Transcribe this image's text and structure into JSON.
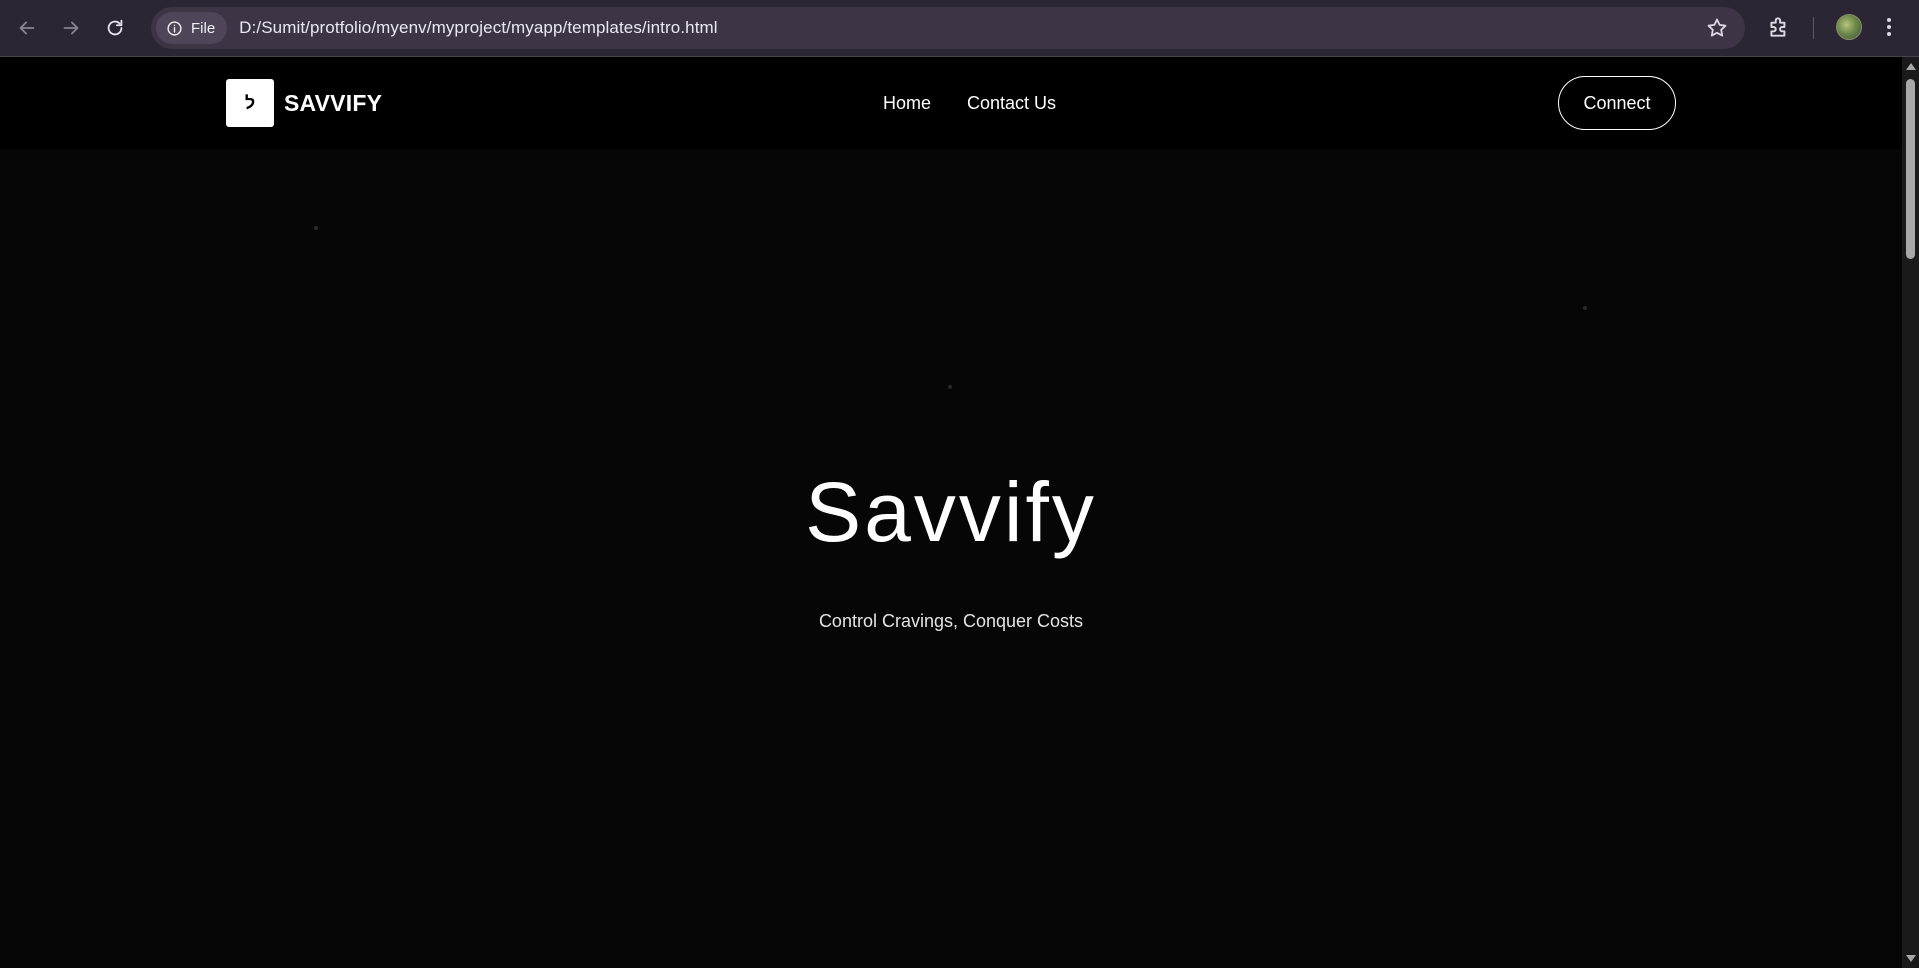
{
  "browser": {
    "site_chip_label": "File",
    "url": "D:/Sumit/protfolio/myenv/myproject/myapp/templates/intro.html",
    "icons": [
      "back-arrow-icon",
      "forward-arrow-icon",
      "reload-icon",
      "info-icon",
      "star-icon",
      "extensions-icon",
      "profile-avatar",
      "more-vert-icon"
    ]
  },
  "site": {
    "logo_glyph": "ל",
    "brand_name": "SAVVIFY",
    "nav": [
      {
        "label": "Home"
      },
      {
        "label": "Contact Us"
      }
    ],
    "connect_label": "Connect"
  },
  "hero": {
    "title": "Savvify",
    "subtitle": "Control Cravings, Conquer Costs"
  },
  "colors": {
    "chrome_bg": "#2c2533",
    "omnibox_bg": "#3d3446",
    "page_bg": "#060606",
    "header_bg": "#000000",
    "text": "#ffffff"
  }
}
